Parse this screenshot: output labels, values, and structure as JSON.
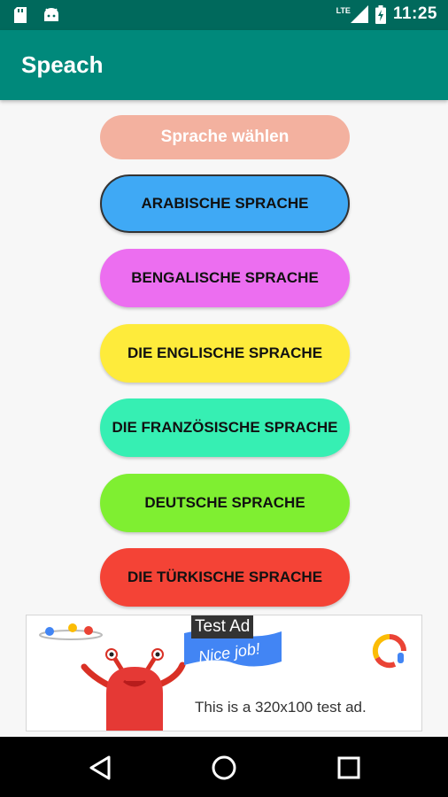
{
  "status_bar": {
    "time": "11:25",
    "network": "LTE",
    "icons": [
      "sd-card-icon",
      "android-icon",
      "signal-icon",
      "battery-icon"
    ]
  },
  "app_bar": {
    "title": "Speach"
  },
  "select_language": {
    "label": "Sprache wählen",
    "color": "#f3b19f"
  },
  "languages": [
    {
      "label": "ARABISCHE SPRACHE",
      "color": "#3fa9f5"
    },
    {
      "label": "BENGALISCHE SPRACHE",
      "color": "#ec6ef0"
    },
    {
      "label": "DIE ENGLISCHE SPRACHE",
      "color": "#feeb3b"
    },
    {
      "label": "DIE FRANZÖSISCHE SPRACHE",
      "color": "#36efb3"
    },
    {
      "label": "DEUTSCHE SPRACHE",
      "color": "#7fef31"
    },
    {
      "label": "DIE TÜRKISCHE SPRACHE",
      "color": "#f44336"
    }
  ],
  "ad": {
    "label": "Test Ad",
    "banner_text": "Nice job!",
    "description": "This is a 320x100 test ad."
  },
  "nav_bar": {
    "buttons": [
      "back-icon",
      "home-icon",
      "recents-icon"
    ]
  }
}
